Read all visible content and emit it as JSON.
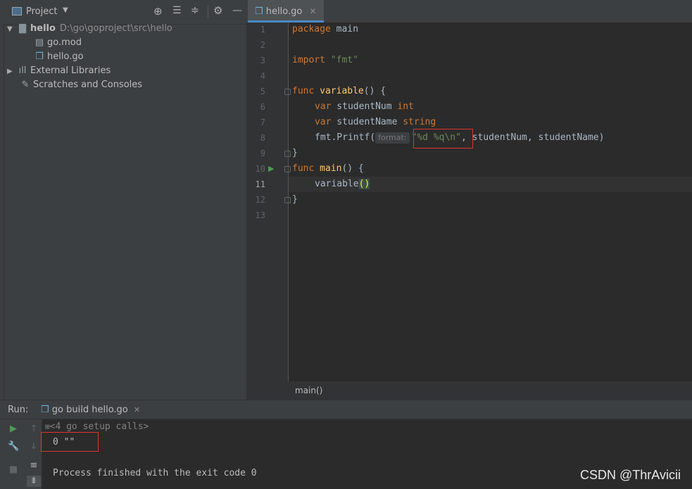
{
  "project_panel": {
    "title": "Project",
    "tree": {
      "root_name": "hello",
      "root_path": "D:\\go\\goproject\\src\\hello",
      "files": [
        "go.mod",
        "hello.go"
      ],
      "external_libraries": "External Libraries",
      "scratches": "Scratches and Consoles"
    }
  },
  "editor": {
    "tab_label": "hello.go",
    "line_numbers": [
      "1",
      "2",
      "3",
      "4",
      "5",
      "6",
      "7",
      "8",
      "9",
      "10",
      "11",
      "12",
      "13"
    ],
    "code": {
      "l1_kw": "package",
      "l1_rest": " main",
      "l3_kw": "import",
      "l3_str": "\"fmt\"",
      "l5_kw": "func",
      "l5_fn": "variable",
      "l5_rest": "() {",
      "l6_kw": "var",
      "l6_name": " studentNum ",
      "l6_type": "int",
      "l7_kw": "var",
      "l7_name": " studentName ",
      "l7_type": "string",
      "l8_call": "fmt.Printf(",
      "l8_hint": "format:",
      "l8_str": "\"%d %q\\n\"",
      "l8_rest": ", studentNum, studentName)",
      "l9": "}",
      "l10_kw": "func",
      "l10_fn": "main",
      "l10_rest": "() {",
      "l11_call": "variable",
      "l11_parens": "()",
      "l12": "}"
    },
    "breadcrumb": "main()"
  },
  "run_panel": {
    "label": "Run:",
    "tab_label": "go build hello.go",
    "console": {
      "setup_calls": "<4 go setup calls>",
      "output": "0 \"\"",
      "finished": "Process finished with the exit code 0"
    }
  },
  "watermark": "CSDN @ThrAvicii",
  "colors": {
    "keyword": "#cc7832",
    "function": "#ffc66d",
    "string": "#6a8759",
    "highlight_box": "#e0332b"
  }
}
